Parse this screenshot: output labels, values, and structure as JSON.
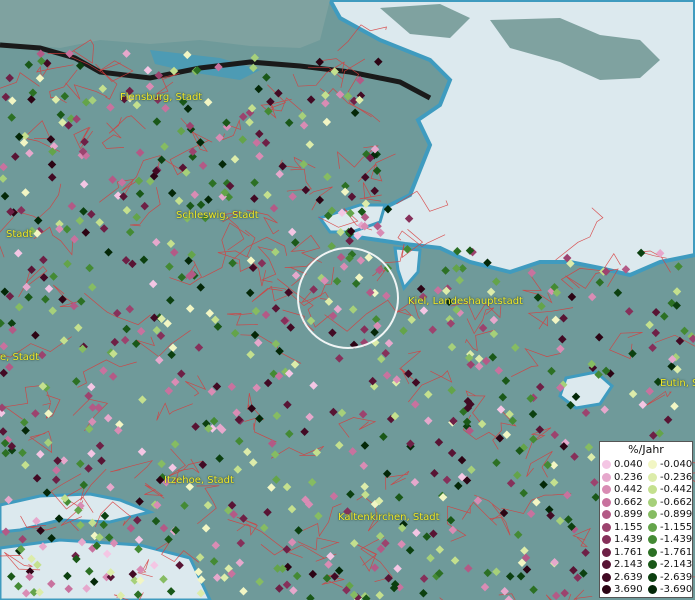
{
  "places": [
    {
      "id": "flensburg",
      "label": "Flensburg, Stadt"
    },
    {
      "id": "schleswig",
      "label": "Schleswig, Stadt"
    },
    {
      "id": "stadt-west",
      "label": "Stadt"
    },
    {
      "id": "kiel",
      "label": "Kiel, Landeshauptstadt"
    },
    {
      "id": "ue-stadt",
      "label": "e, Stadt"
    },
    {
      "id": "eutin",
      "label": "Eutin, S"
    },
    {
      "id": "itzehoe",
      "label": "Itzehoe, Stadt"
    },
    {
      "id": "kaltenkirchen",
      "label": "Kaltenkirchen, Stadt"
    }
  ],
  "legend": {
    "title": "%/Jahr",
    "positive": [
      {
        "value": "0.040",
        "color": "#f4c6e4"
      },
      {
        "value": "0.236",
        "color": "#e6a8cc"
      },
      {
        "value": "0.442",
        "color": "#d98cb4"
      },
      {
        "value": "0.662",
        "color": "#c8729e"
      },
      {
        "value": "0.899",
        "color": "#b35a86"
      },
      {
        "value": "1.155",
        "color": "#9c436e"
      },
      {
        "value": "1.439",
        "color": "#86305a"
      },
      {
        "value": "1.761",
        "color": "#6e2046"
      },
      {
        "value": "2.143",
        "color": "#581434"
      },
      {
        "value": "2.639",
        "color": "#420a24"
      },
      {
        "value": "3.690",
        "color": "#2c0414"
      }
    ],
    "negative": [
      {
        "value": "-0.040",
        "color": "#f2f6c4"
      },
      {
        "value": "-0.236",
        "color": "#dcecaa"
      },
      {
        "value": "-0.442",
        "color": "#c4e08e"
      },
      {
        "value": "-0.662",
        "color": "#a6d07a"
      },
      {
        "value": "-0.899",
        "color": "#86bc62"
      },
      {
        "value": "-1.155",
        "color": "#64a44a"
      },
      {
        "value": "-1.439",
        "color": "#448a34"
      },
      {
        "value": "-1.761",
        "color": "#2c7024"
      },
      {
        "value": "-2.143",
        "color": "#1a5818"
      },
      {
        "value": "-2.639",
        "color": "#0c4010"
      },
      {
        "value": "-3.690",
        "color": "#042808"
      }
    ]
  },
  "colors": {
    "land": "#6f9a9a",
    "sea": "#dce9ee",
    "water_edge": "#3f9bbf",
    "denmark": "#7fa2a0",
    "border": "#1a1a1a",
    "boundaries": "#d83c3c",
    "label": "#f2ea2a",
    "focus_ring": "#ffffff"
  }
}
